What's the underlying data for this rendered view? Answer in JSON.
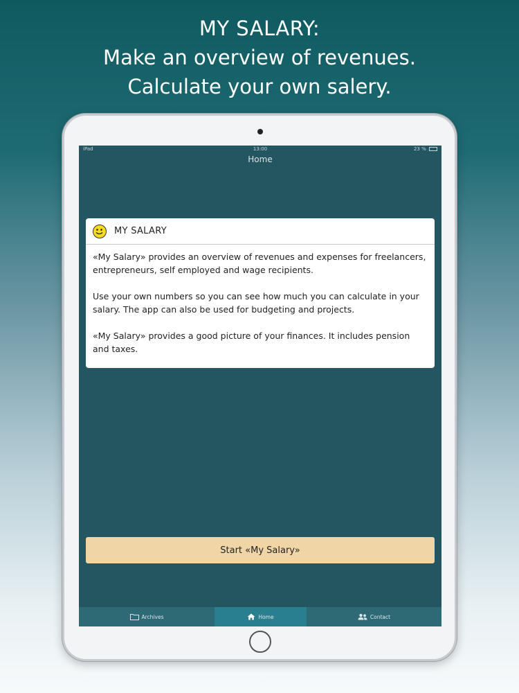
{
  "promo": {
    "line1": "MY SALARY:",
    "line2": "Make an overview of revenues.",
    "line3": "Calculate your own salery."
  },
  "status_bar": {
    "device": "iPad",
    "time": "13:00",
    "battery": "23 %"
  },
  "nav": {
    "title": "Home"
  },
  "card": {
    "icon": "smiley-icon",
    "title": "MY SALARY",
    "paragraphs": [
      "«My Salary» provides an overview of revenues and expenses for freelancers, entrepreneurs, self employed and wage recipients.",
      "Use your own numbers so you can see how much you can calculate in your salary. The app can also be used for budgeting and projects.",
      "«My Salary» provides a good picture of your finances. It includes pension and taxes."
    ]
  },
  "start_button": {
    "label": "Start «My Salary»"
  },
  "tabs": [
    {
      "label": "Archives",
      "icon": "folder-icon",
      "selected": false
    },
    {
      "label": "Home",
      "icon": "home-icon",
      "selected": true
    },
    {
      "label": "Contact",
      "icon": "people-icon",
      "selected": false
    }
  ],
  "colors": {
    "screen_bg": "#245661",
    "button_bg": "#f0d6a7",
    "tab_selected": "#2a7f8f"
  }
}
